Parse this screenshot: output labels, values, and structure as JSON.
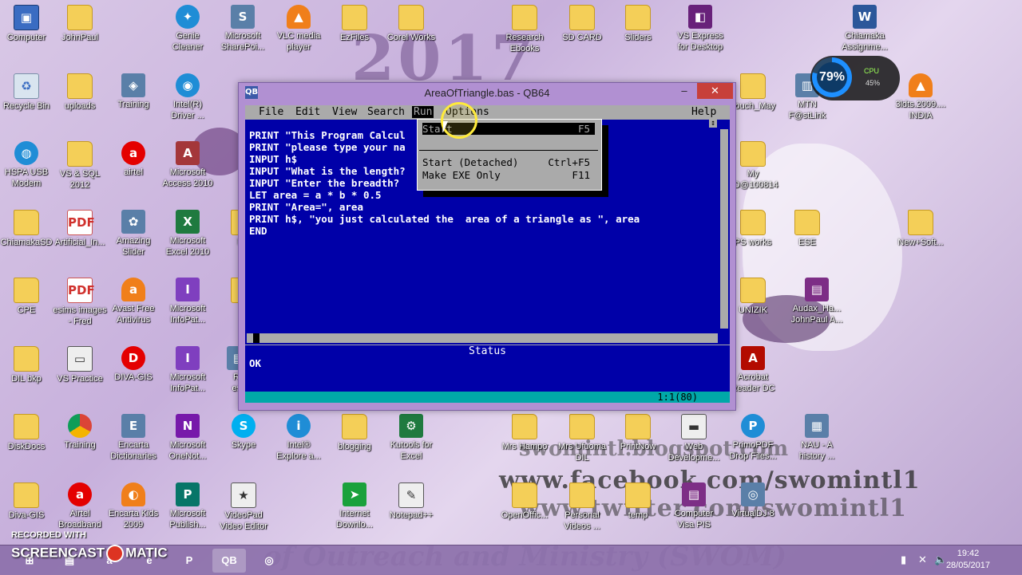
{
  "window": {
    "title": "AreaOfTriangle.bas - QB64",
    "icon_text": "QB",
    "minimize": "–",
    "maximize": "☐",
    "close": "✕"
  },
  "qb64": {
    "menus": [
      "File",
      "Edit",
      "View",
      "Search",
      "Run",
      "Options",
      "Help"
    ],
    "active_menu": "Run",
    "run_menu": [
      {
        "label": "Start",
        "shortcut": "F5"
      },
      {
        "label": "Start (Detached)",
        "shortcut": "Ctrl+F5"
      },
      {
        "label": "Make EXE Only",
        "shortcut": "F11"
      }
    ],
    "code_lines": [
      "PRINT \"This Program Calcul",
      "PRINT \"please type your na",
      "INPUT h$",
      "INPUT \"What is the length?",
      "INPUT \"Enter the breadth?",
      "LET area = a * b * 0.5",
      "PRINT \"Area=\", area",
      "PRINT h$, \"you just calculated the  area of a triangle as \", area",
      "END"
    ],
    "status_label": "Status",
    "status_text": "OK",
    "cursor_position": "1:1(80)",
    "scroll_marker": "↕"
  },
  "desktop_icons": [
    {
      "label": "Computer",
      "icon": "computer-icon",
      "glyph": "▣",
      "style": "g-computer"
    },
    {
      "label": "JohnPaul",
      "icon": "folder-icon",
      "glyph": "",
      "style": "g-folder"
    },
    {
      "label": "Genie\nCleaner",
      "icon": "genie-icon",
      "glyph": "✦",
      "style": "g-ie"
    },
    {
      "label": "Microsoft\nSharePoi...",
      "icon": "sharepoint-icon",
      "glyph": "S",
      "style": "g-generic"
    },
    {
      "label": "VLC media\nplayer",
      "icon": "vlc-icon",
      "glyph": "▲",
      "style": "g-vlc"
    },
    {
      "label": "EzFiles",
      "icon": "folder-icon",
      "glyph": "",
      "style": "g-folder"
    },
    {
      "label": "Corel Works",
      "icon": "folder-icon",
      "glyph": "",
      "style": "g-folder"
    },
    {
      "label": "Research\nEbooks",
      "icon": "folder-icon",
      "glyph": "",
      "style": "g-folder"
    },
    {
      "label": "SD CARD",
      "icon": "folder-icon",
      "glyph": "",
      "style": "g-folder"
    },
    {
      "label": "Sliders",
      "icon": "folder-icon",
      "glyph": "",
      "style": "g-folder"
    },
    {
      "label": "VS Express\nfor Desktop",
      "icon": "visual-studio-icon",
      "glyph": "◧",
      "style": "g-vs"
    },
    {
      "label": "Chiamaka\nAssignme...",
      "icon": "word-doc-icon",
      "glyph": "W",
      "style": "g-word"
    },
    {
      "label": "Recycle Bin",
      "icon": "recycle-bin-icon",
      "glyph": "♻",
      "style": "g-recycle"
    },
    {
      "label": "uploads",
      "icon": "folder-icon",
      "glyph": "",
      "style": "g-folder"
    },
    {
      "label": "Training",
      "icon": "training-icon",
      "glyph": "◈",
      "style": "g-generic"
    },
    {
      "label": "Intel(R)\nDriver ...",
      "icon": "intel-driver-icon",
      "glyph": "◉",
      "style": "g-ie"
    },
    {
      "label": "Touch_May",
      "icon": "folder-icon",
      "glyph": "",
      "style": "g-folder"
    },
    {
      "label": "MTN\nF@stLink",
      "icon": "mtn-icon",
      "glyph": "▥",
      "style": "g-generic"
    },
    {
      "label": "3ldts.2009....\nINDIA",
      "icon": "vlc-file-icon",
      "glyph": "▲",
      "style": "g-vlc"
    },
    {
      "label": "HSPA USB\nModem",
      "icon": "modem-icon",
      "glyph": "◍",
      "style": "g-ie"
    },
    {
      "label": "VS & SQL\n2012",
      "icon": "folder-icon",
      "glyph": "",
      "style": "g-folder"
    },
    {
      "label": "airtel",
      "icon": "airtel-icon",
      "glyph": "a",
      "style": "g-airtel"
    },
    {
      "label": "Microsoft\nAccess 2010",
      "icon": "access-icon",
      "glyph": "A",
      "style": "g-access"
    },
    {
      "label": "My\nSD@100814",
      "icon": "folder-icon",
      "glyph": "",
      "style": "g-folder"
    },
    {
      "label": "ChiamakaSD",
      "icon": "folder-icon",
      "glyph": "",
      "style": "g-folder"
    },
    {
      "label": "Artificial_In...",
      "icon": "pdf-icon",
      "glyph": "PDF",
      "style": "g-pdf"
    },
    {
      "label": "Amazing\nSlider",
      "icon": "amazing-slider-icon",
      "glyph": "✿",
      "style": "g-generic"
    },
    {
      "label": "Microsoft\nExcel 2010",
      "icon": "excel-icon",
      "glyph": "X",
      "style": "g-excel"
    },
    {
      "label": "NC",
      "icon": "folder-icon",
      "glyph": "",
      "style": "g-folder"
    },
    {
      "label": "PS works",
      "icon": "folder-icon",
      "glyph": "",
      "style": "g-folder"
    },
    {
      "label": "ESE",
      "icon": "folder-icon",
      "glyph": "",
      "style": "g-folder"
    },
    {
      "label": "New+Soft...",
      "icon": "folder-icon",
      "glyph": "",
      "style": "g-folder"
    },
    {
      "label": "CPE",
      "icon": "folder-icon",
      "glyph": "",
      "style": "g-folder"
    },
    {
      "label": "esims images\n- Fred",
      "icon": "pdf-icon",
      "glyph": "PDF",
      "style": "g-pdf"
    },
    {
      "label": "Avast Free\nAntivirus",
      "icon": "avast-icon",
      "glyph": "a",
      "style": "g-vlc"
    },
    {
      "label": "Microsoft\nInfoPat...",
      "icon": "infopath-icon",
      "glyph": "I",
      "style": "g-infopath"
    },
    {
      "label": "N",
      "icon": "folder-icon",
      "glyph": "",
      "style": "g-folder"
    },
    {
      "label": "UNIZIK",
      "icon": "folder-icon",
      "glyph": "",
      "style": "g-folder"
    },
    {
      "label": "Audax_Ha...\nJohnPaul A...",
      "icon": "winrar-icon",
      "glyph": "▤",
      "style": "g-winrar"
    },
    {
      "label": "DIL bkp",
      "icon": "folder-icon",
      "glyph": "",
      "style": "g-folder"
    },
    {
      "label": "VS Practice",
      "icon": "vs-practice-icon",
      "glyph": "▭",
      "style": "g-screen"
    },
    {
      "label": "DIVA-GIS",
      "icon": "diva-gis-icon",
      "glyph": "D",
      "style": "g-airtel"
    },
    {
      "label": "Microsoft\nInfoPat...",
      "icon": "infopath-icon",
      "glyph": "I",
      "style": "g-infopath"
    },
    {
      "label": "Ra\ness",
      "icon": "generic-file-icon",
      "glyph": "▤",
      "style": "g-generic"
    },
    {
      "label": "Acrobat\nReader DC",
      "icon": "acrobat-icon",
      "glyph": "A",
      "style": "g-acrobat"
    },
    {
      "label": "DiskDocs",
      "icon": "folder-icon",
      "glyph": "",
      "style": "g-folder"
    },
    {
      "label": "Training",
      "icon": "chrome-icon",
      "glyph": "",
      "style": "g-chrome"
    },
    {
      "label": "Encarta\nDictionaries",
      "icon": "encarta-icon",
      "glyph": "E",
      "style": "g-generic"
    },
    {
      "label": "Microsoft\nOneNot...",
      "icon": "onenote-icon",
      "glyph": "N",
      "style": "g-onenote"
    },
    {
      "label": "Skype",
      "icon": "skype-icon",
      "glyph": "S",
      "style": "g-skype"
    },
    {
      "label": "Intel®\nExplore a...",
      "icon": "intel-icon",
      "glyph": "i",
      "style": "g-ie"
    },
    {
      "label": "blogging",
      "icon": "folder-icon",
      "glyph": "",
      "style": "g-folder"
    },
    {
      "label": "Kutools for\nExcel",
      "icon": "kutools-icon",
      "glyph": "⚙",
      "style": "g-excel"
    },
    {
      "label": "Mrs Hampo",
      "icon": "folder-icon",
      "glyph": "",
      "style": "g-folder"
    },
    {
      "label": "Mrs Ufuoma\nDIL",
      "icon": "folder-icon",
      "glyph": "",
      "style": "g-folder"
    },
    {
      "label": "PrintNow",
      "icon": "folder-icon",
      "glyph": "",
      "style": "g-folder"
    },
    {
      "label": "Web\nDevelopme...",
      "icon": "web-dev-icon",
      "glyph": "▬",
      "style": "g-screen"
    },
    {
      "label": "PrimoPDF\nDrop Files...",
      "icon": "primopdf-icon",
      "glyph": "P",
      "style": "g-ie"
    },
    {
      "label": "NAU - A\nhistory ...",
      "icon": "nau-icon",
      "glyph": "▦",
      "style": "g-generic"
    },
    {
      "label": "Diva-GIS",
      "icon": "folder-icon",
      "glyph": "",
      "style": "g-folder"
    },
    {
      "label": "Airtel\nBroadband",
      "icon": "airtel-icon",
      "glyph": "a",
      "style": "g-airtel"
    },
    {
      "label": "Encarta Kids\n2009",
      "icon": "encarta-kids-icon",
      "glyph": "◐",
      "style": "g-vlc"
    },
    {
      "label": "Microsoft\nPublish...",
      "icon": "publisher-icon",
      "glyph": "P",
      "style": "g-publisher"
    },
    {
      "label": "VideoPad\nVideo Editor",
      "icon": "videopad-icon",
      "glyph": "★",
      "style": "g-screen"
    },
    {
      "label": "Internet\nDownlo...",
      "icon": "internet-download-icon",
      "glyph": "➤",
      "style": "g-flag"
    },
    {
      "label": "Notepad++",
      "icon": "notepadpp-icon",
      "glyph": "✎",
      "style": "g-screen"
    },
    {
      "label": "OpenOffic...",
      "icon": "folder-icon",
      "glyph": "",
      "style": "g-folder"
    },
    {
      "label": "Personal\nVideos ...",
      "icon": "folder-icon",
      "glyph": "",
      "style": "g-folder"
    },
    {
      "label": "temp",
      "icon": "folder-icon",
      "glyph": "",
      "style": "g-folder"
    },
    {
      "label": "Computer\nVisa PIS",
      "icon": "winrar-icon",
      "glyph": "▤",
      "style": "g-winrar"
    },
    {
      "label": "VirtualDJ 8",
      "icon": "virtualdj-icon",
      "glyph": "◎",
      "style": "g-generic"
    }
  ],
  "cpu_widget": {
    "percent_text": "79%",
    "label": "CPU",
    "value": "45%",
    "ring_fill": 0.79
  },
  "watermark": {
    "year": "2017",
    "blog": "swomintl.blogspot.com",
    "facebook": "www.facebook.com/swomintl1",
    "twitter": "www.twitter.com/swomintl1",
    "bottom": "of Outreach and Ministry (SWOM)"
  },
  "screencast": {
    "recorded_with": "RECORDED WITH",
    "name_left": "SCREENCAST",
    "name_right": "MATIC"
  },
  "taskbar": {
    "apps": [
      {
        "name": "taskbar-start-button",
        "glyph": "⊞"
      },
      {
        "name": "taskbar-explorer-button",
        "glyph": "▤"
      },
      {
        "name": "taskbar-airtel-button",
        "glyph": "a"
      },
      {
        "name": "taskbar-ie-button",
        "glyph": "e"
      },
      {
        "name": "taskbar-powerpoint-button",
        "glyph": "P"
      },
      {
        "name": "taskbar-qb64-button",
        "glyph": "QB"
      },
      {
        "name": "taskbar-app-button",
        "glyph": "◎"
      }
    ],
    "clock_time": "19:42",
    "clock_date": "28/05/2017"
  }
}
